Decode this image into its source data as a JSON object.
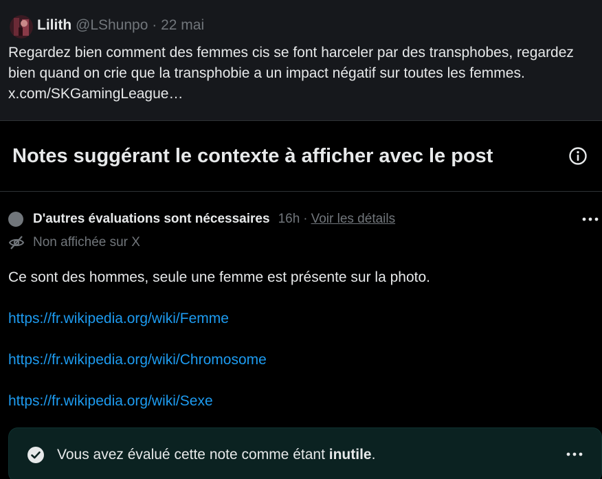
{
  "post": {
    "author": "Lilith",
    "handle": "@LShunpo",
    "separator": "·",
    "date": "22 mai",
    "text": "Regardez bien comment des femmes cis se font harceler par des transphobes, regardez bien quand on crie que la transphobie a un impact négatif sur toutes les femmes.",
    "link": "x.com/SKGamingLeague…"
  },
  "notes_section": {
    "title": "Notes suggérant le contexte à afficher avec le post",
    "info_icon": "info-icon"
  },
  "note": {
    "status_label": "D'autres évaluations sont nécessaires",
    "time": "16h",
    "separator": "·",
    "details_link": "Voir les détails",
    "visibility": "Non affichée sur X",
    "text": "Ce sont des hommes, seule une femme est présente sur la photo.",
    "links": [
      "https://fr.wikipedia.org/wiki/Femme",
      "https://fr.wikipedia.org/wiki/Chromosome",
      "https://fr.wikipedia.org/wiki/Sexe"
    ]
  },
  "rating": {
    "prefix": "Vous avez évalué cette note comme étant ",
    "value": "inutile",
    "suffix": "."
  },
  "colors": {
    "background": "#000000",
    "post_background": "#16181c",
    "link": "#1d9bf0",
    "muted": "#71767b",
    "rating_box": "#0b2221"
  }
}
